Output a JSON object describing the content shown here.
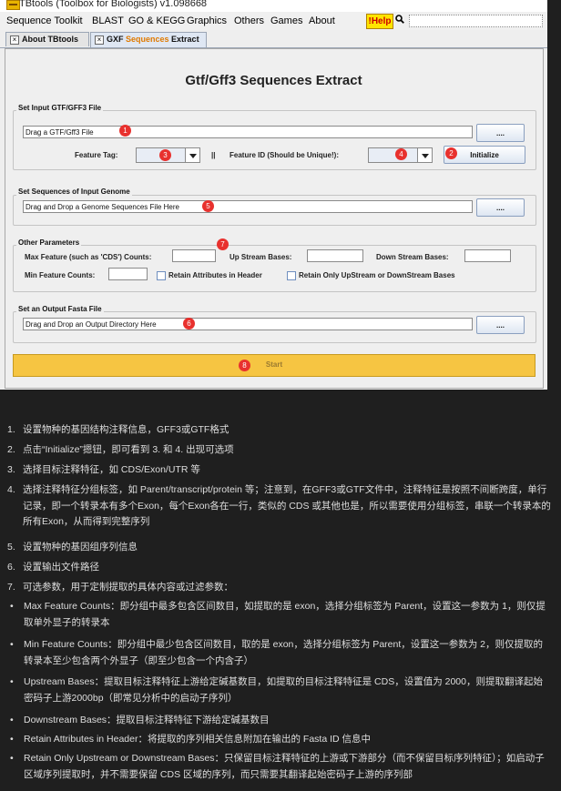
{
  "window": {
    "title": "TBtools (Toolbox for Biologists) v1.098668"
  },
  "menubar": {
    "items": [
      "Sequence Toolkit",
      "BLAST",
      "GO & KEGG",
      "Graphics",
      "Others",
      "Games",
      "About"
    ],
    "help_label": "!Help"
  },
  "tabs": [
    {
      "label": "About TBtools"
    },
    {
      "label_prefix": "GXF ",
      "label_highlight": "Sequences",
      "label_suffix": " Extract"
    }
  ],
  "page": {
    "title": "Gtf/Gff3 Sequences Extract"
  },
  "gtf_section": {
    "title": "Set Input GTF/GFF3 File",
    "placeholder": "Drag a GTF/Gff3 File",
    "browse_label": "....",
    "feature_tag_label": "Feature Tag:",
    "separator": "||",
    "feature_id_label": "Feature ID (Should be Unique!):",
    "initialize_label": "Initialize"
  },
  "genome_section": {
    "title": "Set Sequences of Input Genome",
    "placeholder": "Drag and Drop a Genome Sequences File Here",
    "browse_label": "...."
  },
  "params_section": {
    "title": "Other Parameters",
    "max_feature_label": "Max Feature (such as 'CDS') Counts:",
    "upstream_label": "Up Stream Bases:",
    "downstream_label": "Down Stream Bases:",
    "min_feature_label": "Min Feature Counts:",
    "retain_attr_label": "Retain Attributes in Header",
    "retain_only_label": "Retain Only UpStream or DownStream Bases"
  },
  "output_section": {
    "title": "Set an Output Fasta File",
    "placeholder": "Drag and Drop an Output Directory Here",
    "browse_label": "...."
  },
  "start_label": "Start",
  "badges": [
    "1",
    "2",
    "3",
    "4",
    "5",
    "6",
    "7",
    "8"
  ],
  "notes": [
    {
      "num": "1.",
      "text": "设置物种的基因结构注释信息，GFF3或GTF格式"
    },
    {
      "num": "2.",
      "text": "点击“Initialize”摁钮，即可看到 3. 和 4. 出现可选项"
    },
    {
      "num": "3.",
      "text": "选择目标注释特征，如 CDS/Exon/UTR 等"
    },
    {
      "num": "4.",
      "text": "选择注释特征分组标签，如 Parent/transcript/protein 等；注意到，在GFF3或GTF文件中，注释特征是按照不间断跨度，单行记录，即一个转录本有多个Exon，每个Exon各在一行，类似的 CDS 或其他也是，所以需要使用分组标签，串联一个转录本的所有Exon，从而得到完整序列"
    },
    {
      "num": "5.",
      "text": "设置物种的基因组序列信息"
    },
    {
      "num": "6.",
      "text": "设置输出文件路径"
    },
    {
      "num": "7.",
      "text": "可选参数，用于定制提取的具体内容或过滤参数："
    }
  ],
  "subnotes": [
    {
      "text": "Max Feature Counts：即分组中最多包含区间数目，如提取的是 exon，选择分组标签为 Parent，设置这一参数为 1，则仅提取单外显子的转录本"
    },
    {
      "text": "Min Feature Counts：即分组中最少包含区间数目，取的是 exon，选择分组标签为 Parent，设置这一参数为 2，则仅提取的转录本至少包含两个外显子（即至少包含一个内含子）"
    },
    {
      "text": "Upstream Bases：提取目标注释特征上游给定碱基数目，如提取的目标注释特征是 CDS，设置值为 2000，则提取翻译起始密码子上游2000bp（即常见分析中的启动子序列）"
    },
    {
      "text": "Downstream Bases：提取目标注释特征下游给定碱基数目"
    },
    {
      "text": "Retain Attributes in Header：将提取的序列相关信息附加在输出的 Fasta ID 信息中"
    },
    {
      "text": "Retain Only Upstream or Downstream Bases：只保留目标注释特征的上游或下游部分（而不保留目标序列特征）；如启动子区域序列提取时，并不需要保留 CDS 区域的序列，而只需要其翻译起始密码子上游的序列部"
    }
  ],
  "colors": {
    "start_bar": "#f6c542",
    "badge": "#e8312e",
    "help_button": "#ffe400",
    "tab_highlight": "#e07a00"
  }
}
